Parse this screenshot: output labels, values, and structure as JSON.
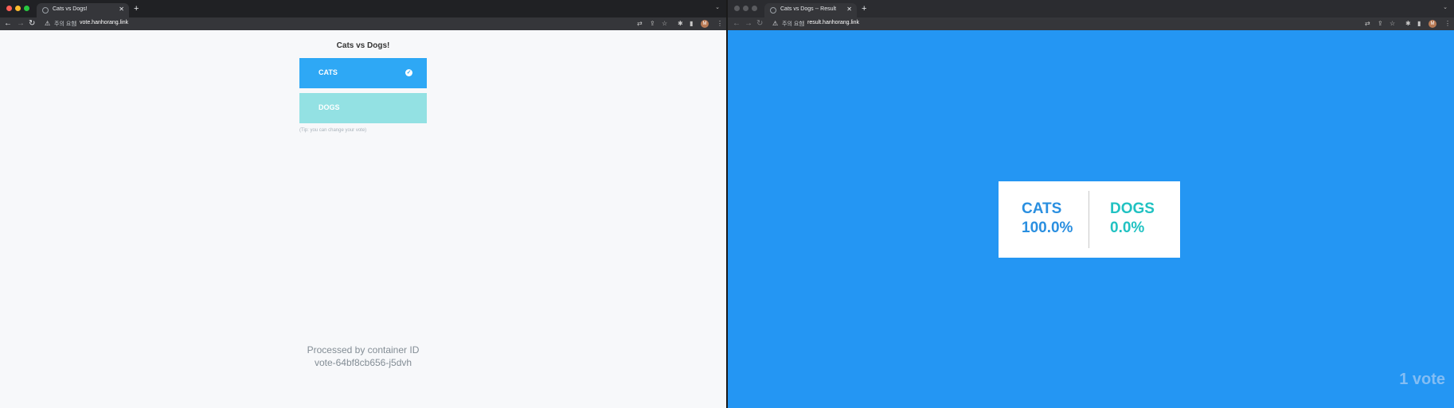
{
  "left": {
    "tab_title": "Cats vs Dogs!",
    "warning": "주의 요함",
    "url": "vote.hanhorang.link",
    "page_title": "Cats vs Dogs!",
    "options": [
      {
        "label": "CATS",
        "selected": true
      },
      {
        "label": "DOGS",
        "selected": false
      }
    ],
    "tip": "(Tip: you can change your vote)",
    "processed_label": "Processed by container ID",
    "container_id": "vote-64bf8cb656-j5dvh"
  },
  "right": {
    "tab_title": "Cats vs Dogs -- Result",
    "warning": "주의 요함",
    "url": "result.hanhorang.link",
    "cats_label": "CATS",
    "cats_pct": "100.0%",
    "dogs_label": "DOGS",
    "dogs_pct": "0.0%",
    "votes": "1 vote"
  },
  "browser": {
    "avatar_initial": "M"
  },
  "colors": {
    "cats_button": "#2ea8f5",
    "dogs_button": "#93e1e3",
    "result_bg": "#2496f3",
    "cats_text": "#2a8fe0",
    "dogs_text": "#21c2c2"
  }
}
